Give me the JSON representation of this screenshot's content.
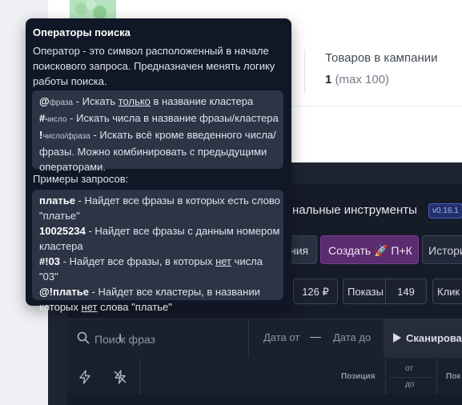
{
  "campaign": {
    "label": "Товаров в кампании",
    "count": "1",
    "max": "(max 100)"
  },
  "panel": {
    "title": "нальные инструменты",
    "version": "v0.16.1"
  },
  "toolbar": {
    "partial_label": "ния",
    "create_label": "Создать 🚀 П+К",
    "history_label": "Истори"
  },
  "filters": {
    "price": "126 ₽",
    "shows_label": "Показы",
    "shows_value": "149",
    "clicks_label": "Клик"
  },
  "search": {
    "placeholder": "Поиск фраз",
    "date_from": "Дата от",
    "date_dash": "—",
    "date_to": "Дата до",
    "scan_label": "Сканироват"
  },
  "table_head": {
    "position": "Позиция",
    "from": "от",
    "to": "до",
    "shows": "Пок"
  },
  "tooltip": {
    "title": "Операторы поиска",
    "description": "Оператор - это символ расположенный в начале поискового запроса. Предназначен менять логику работы поиска.",
    "operators": [
      {
        "symbol": "@",
        "arg": "фраза",
        "pre": " - Искать ",
        "emph": "только",
        "post": " в название кластера"
      },
      {
        "symbol": "#",
        "arg": "число",
        "pre": " - Искать числа в название фразы/кластера",
        "emph": "",
        "post": ""
      },
      {
        "symbol": "!",
        "arg": "число/фраза",
        "pre": " - Искать всё кроме введенного числа/фразы. Можно комбинировать с предыдущими операторами.",
        "emph": "",
        "post": ""
      }
    ],
    "examples_label": "Примеры запросов:",
    "examples": [
      {
        "query": "платье",
        "pre": " - Найдет все фразы в которых есть слово \"платье\"",
        "emph": "",
        "post": ""
      },
      {
        "query": "10025234",
        "pre": " - Найдет все фразы с данным номером кластера",
        "emph": "",
        "post": ""
      },
      {
        "query": "#!03",
        "pre": " - Найдет все фразы, в которых ",
        "emph": "нет",
        "post": " числа \"03\""
      },
      {
        "query": "@!платье",
        "pre": " - Найдет все кластеры, в названии которых ",
        "emph": "нет",
        "post": " слова \"платье\""
      }
    ]
  },
  "icons": {
    "search": "search-icon",
    "bolt": "bolt-icon",
    "bolt_off": "bolt-off-icon",
    "play": "play-icon"
  },
  "colors": {
    "tooltip_bg": "#101726",
    "create_button": "#5b2c6f",
    "panel_bg": "#1e2433",
    "version_badge": "#4760c9"
  }
}
